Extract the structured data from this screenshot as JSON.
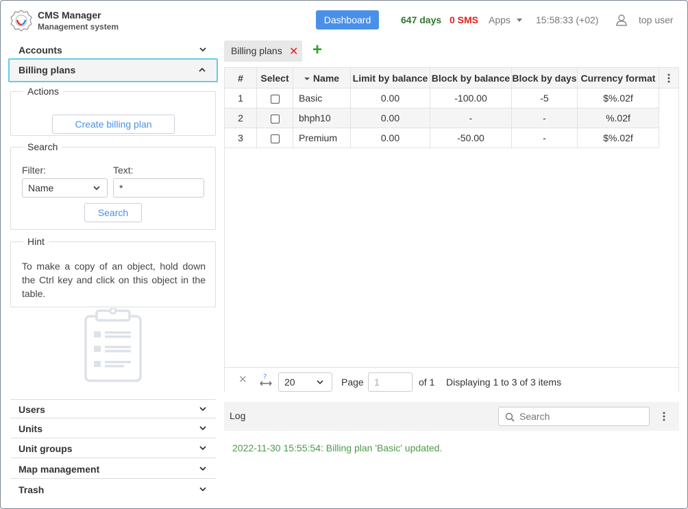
{
  "header": {
    "app_title": "CMS Manager",
    "app_subtitle": "Management system",
    "dashboard_label": "Dashboard",
    "days": "647 days",
    "sms": "0 SMS",
    "apps_label": "Apps",
    "clock": "15:58:33 (+02)",
    "user_name": "top user"
  },
  "sidebar": {
    "accounts_label": "Accounts",
    "billing_plans_label": "Billing plans",
    "actions": {
      "legend": "Actions",
      "create_label": "Create billing plan"
    },
    "search": {
      "legend": "Search",
      "filter_label": "Filter:",
      "filter_value": "Name",
      "text_label": "Text:",
      "text_value": "*",
      "search_button": "Search"
    },
    "hint": {
      "legend": "Hint",
      "text": "To make a copy of an object, hold down the Ctrl key and click on this object in the table."
    },
    "bottom_items": [
      "Users",
      "Units",
      "Unit groups",
      "Map management",
      "Trash"
    ]
  },
  "tabs": {
    "active_label": "Billing plans",
    "close_glyph": "✕",
    "add_glyph": "+"
  },
  "table": {
    "columns": [
      "#",
      "Select",
      "Name",
      "Limit by balance",
      "Block by balance",
      "Block by days",
      "Currency format"
    ],
    "rows": [
      {
        "num": "1",
        "name": "Basic",
        "limit": "0.00",
        "block_balance": "-100.00",
        "block_days": "-5",
        "currency": "$%.02f"
      },
      {
        "num": "2",
        "name": "bhph10",
        "limit": "0.00",
        "block_balance": "-",
        "block_days": "-",
        "currency": "%.02f"
      },
      {
        "num": "3",
        "name": "Premium",
        "limit": "0.00",
        "block_balance": "-50.00",
        "block_days": "-",
        "currency": "$%.02f"
      }
    ]
  },
  "pager": {
    "page_size": "20",
    "page_label": "Page",
    "page_value": "1",
    "of_label": "of 1",
    "displaying": "Displaying 1 to 3 of 3 items",
    "fit_glyph": "?"
  },
  "log": {
    "title": "Log",
    "search_placeholder": "Search",
    "entries": [
      "2022-11-30 15:55:54: Billing plan 'Basic' updated."
    ]
  },
  "colors": {
    "accent": "#4a90e8",
    "days_green": "#2c7a2c",
    "sms_red": "#e0201a",
    "log_green": "#4a9a4a",
    "active_border": "#5fd0e0"
  }
}
